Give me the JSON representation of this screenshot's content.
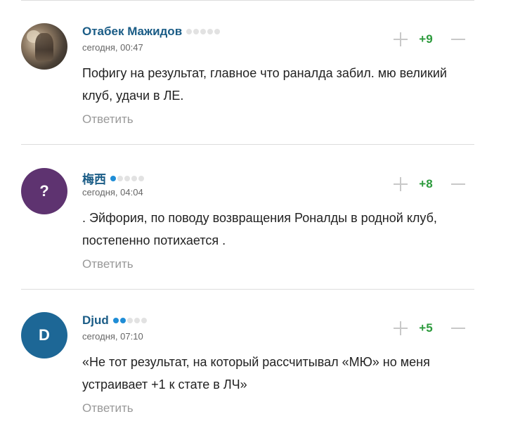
{
  "reply_label": "Ответить",
  "colors": {
    "username": "#1a5c86",
    "score_positive": "#2c9a3c",
    "rating_filled": "#1f8dd6",
    "rating_empty": "#e2e2e2"
  },
  "comments": [
    {
      "author": "Отабек Мажидов",
      "avatar_type": "photo",
      "avatar_letter": "",
      "avatar_color": "",
      "rating_filled": 0,
      "rating_total": 5,
      "timestamp": "сегодня, 00:47",
      "text": "Пофигу на результат, главное что раналда забил. мю великий клуб, удачи в ЛЕ.",
      "score": "+9"
    },
    {
      "author": "梅西",
      "avatar_type": "letter",
      "avatar_letter": "?",
      "avatar_color": "#5e3370",
      "rating_filled": 1,
      "rating_total": 5,
      "timestamp": "сегодня, 04:04",
      "text": ". Эйфория, по поводу возвращения Роналды в родной клуб, постепенно потихается .",
      "score": "+8"
    },
    {
      "author": "Djud",
      "avatar_type": "letter",
      "avatar_letter": "D",
      "avatar_color": "#1d6796",
      "rating_filled": 2,
      "rating_total": 5,
      "timestamp": "сегодня, 07:10",
      "text": "«Не тот результат, на который рассчитывал «МЮ» но меня устраивает +1 к стате в ЛЧ»",
      "score": "+5"
    }
  ]
}
